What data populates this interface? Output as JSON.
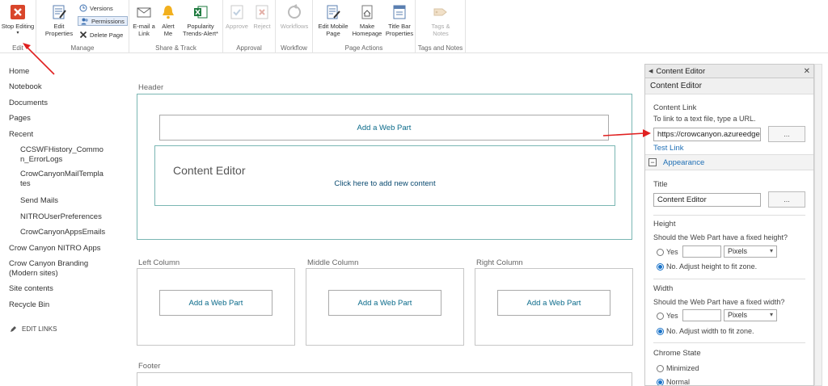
{
  "ribbon": {
    "groups": {
      "edit": "Edit",
      "manage": "Manage",
      "share": "Share & Track",
      "approval": "Approval",
      "workflow": "Workflow",
      "page_actions": "Page Actions",
      "tags": "Tags and Notes"
    },
    "stop_editing": "Stop Editing",
    "edit_properties_1": "Edit",
    "edit_properties_2": "Properties",
    "versions": "Versions",
    "permissions": "Permissions",
    "delete_page": "Delete Page",
    "email_link_1": "E-mail a",
    "email_link_2": "Link",
    "alert_me_1": "Alert",
    "alert_me_2": "Me",
    "popularity_1": "Popularity",
    "popularity_2": "Trends-Alert*",
    "approve": "Approve",
    "reject": "Reject",
    "workflows": "Workflows",
    "edit_mobile_1": "Edit Mobile",
    "edit_mobile_2": "Page",
    "make_homepage_1": "Make",
    "make_homepage_2": "Homepage",
    "title_bar_1": "Title Bar",
    "title_bar_2": "Properties",
    "tags_notes_1": "Tags &",
    "tags_notes_2": "Notes"
  },
  "nav": {
    "home": "Home",
    "notebook": "Notebook",
    "documents": "Documents",
    "pages": "Pages",
    "recent": "Recent",
    "ccswf_1": "CCSWFHistory_Commo",
    "ccswf_2": "n_ErrorLogs",
    "mailtemp_1": "CrowCanyonMailTempla",
    "mailtemp_2": "tes",
    "send_mails": "Send Mails",
    "nitro_prefs": "NITROUserPreferences",
    "apps_emails": "CrowCanyonAppsEmails",
    "nitro_apps": "Crow Canyon NITRO Apps",
    "branding_1": "Crow Canyon Branding",
    "branding_2": "(Modern sites)",
    "site_contents": "Site contents",
    "recycle_bin": "Recycle Bin",
    "edit_links": "EDIT LINKS"
  },
  "page": {
    "header_label": "Header",
    "add_web_part": "Add a Web Part",
    "ce_title": "Content Editor",
    "ce_click": "Click here to add new content",
    "left_column": "Left Column",
    "middle_column": "Middle Column",
    "right_column": "Right Column",
    "footer_label": "Footer"
  },
  "pane": {
    "head": "Content Editor",
    "sub": "Content Editor",
    "content_link": "Content Link",
    "content_link_hint": "To link to a text file, type a URL.",
    "url_value": "https://crowcanyon.azureedge",
    "browse": "...",
    "test_link": "Test Link",
    "appearance": "Appearance",
    "title_label": "Title",
    "title_value": "Content Editor",
    "height_label": "Height",
    "height_q": "Should the Web Part have a fixed height?",
    "yes": "Yes",
    "pixels": "Pixels",
    "height_no": "No. Adjust height to fit zone.",
    "width_label": "Width",
    "width_q": "Should the Web Part have a fixed width?",
    "width_no": "No. Adjust width to fit zone.",
    "chrome_label": "Chrome State",
    "minimized": "Minimized",
    "normal": "Normal"
  },
  "colors": {
    "accent": "#0a6a8a",
    "link": "#1f6fb5",
    "annotation_arrow": "#e02020",
    "stop_icon": "#d9462b"
  }
}
